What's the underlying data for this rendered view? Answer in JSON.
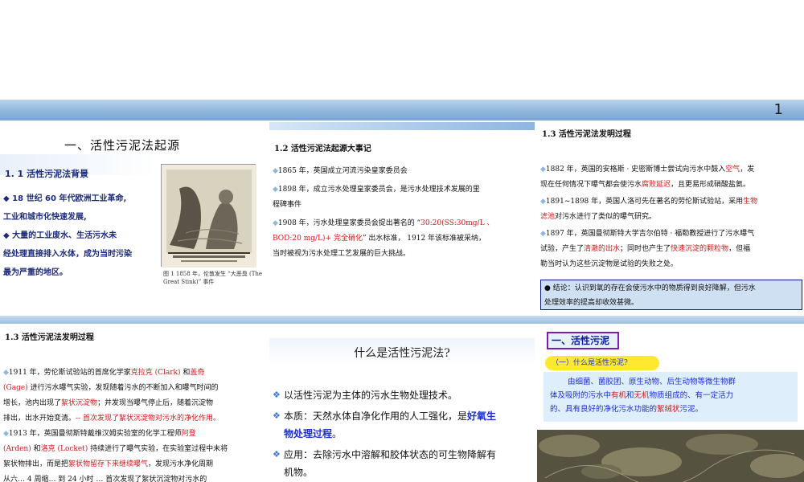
{
  "header": {
    "page_number": "1"
  },
  "panel1": {
    "title": "一、活性污泥法起源",
    "subtitle": "1. 1   活性污泥法背景",
    "lines": [
      "◆     18 世纪 60 年代欧洲工业革命,",
      "工业和城市化快速发展,",
      "◆     大量的工业废水、生活污水未",
      "经处理直接排入水体，成为当时污染",
      "最为严重的地区。"
    ],
    "figure_caption": "图 1 1858 年，伦敦发生 “大恶臭 (The Great Stink)” 事件",
    "figure_inner_text": "FARADAY GIVING HIS CARD TO FATHER THAMES;"
  },
  "panel2": {
    "heading": "1.2  活性污泥法起源大事记",
    "p1": "1865 年，英国成立河流污染皇家委员会",
    "p2a": "1898 年，成立污水处理皇家委员会，是污水处理技术发展的里",
    "p2b": "程碑事件",
    "p3a_pre": "1908 年，污水处理皇家委员会提出著名的 “",
    "p3a_red": "30:20(SS:30mg/L 、",
    "p3b_red": "BOD:20 mg/L)+ 完全硝化",
    "p3b_post": "” 出水标准， 1912 年该标准被采纳，",
    "p3c": "当时被视为污水处理工艺发展的巨大挑战。"
  },
  "panel3": {
    "heading": "1.3  活性污泥法发明过程",
    "a1_pre": "1882 年，英国的安格斯 · 史密斯博士尝试向污水中鼓入",
    "a1_red": "空气",
    "a1_post": "，发",
    "a2_pre": "现在任何情况下曝气都会使污水",
    "a2_red": "腐败延迟",
    "a2_post": "，且更易形成硝酸盐氨。",
    "b1_pre": "1891~1898 年，英国人洛可先在著名的劳伦斯试验站，采用",
    "b1_red": "生物",
    "b2_red": "滤池",
    "b2_post": "对污水进行了类似的曝气研究。",
    "c1": "1897 年，英国曼彻斯特大学吉尔伯特 · 福勒教授进行了污水曝气",
    "c2_pre": "试验，产生了",
    "c2_red1": "清澈的出水",
    "c2_mid": "；同时也产生了",
    "c2_red2": "快速沉淀的颗粒物",
    "c2_post": "，但福",
    "c3": "勒当时认为这些沉淀物是试验的失败之处。",
    "conclusion1": "●  结论：认识到氧的存在会使污水中的物质得到良好降解，但污水",
    "conclusion2": "处理效率的提高却收效甚微。"
  },
  "panel4": {
    "heading": "1.3  活性污泥法发明过程",
    "l1_pre": "1911 年，劳伦斯试验站的首席化学家",
    "l1_red1": "克拉克 (Clark)",
    "l1_mid": " 和",
    "l1_red2": "盖奇",
    "l2_red": "(Gage)",
    "l2_post": " 进行污水曝气实验，发现随着污水的不断加入和曝气时间的",
    "l3_pre": "增长，池内出现了",
    "l3_red": "絮状沉淀物",
    "l3_post": "；并发现当曝气停止后，随着沉淀物",
    "l4_pre": "排出，出水开始变清。",
    "l4_red": "-- 首次发现了絮状沉淀物对污水的净化作用。",
    "l5_pre": "1913 年，英国曼彻斯特戴维汉姆实验室的化学工程师",
    "l5_red": "阿登",
    "l6_red1": "(Arden)",
    "l6_mid": " 和",
    "l6_red2": "洛克 (Locket)",
    "l6_post": " 持续进行了曝气实验，在实验室过程中未将",
    "l7_pre": "絮状物排出，而是把",
    "l7_red": "絮状物留存下来继续曝气",
    "l7_post": "，发现污水净化周期",
    "l8": "从六… 4 周缩… 到 24 小时 … 首次发现了絮状沉淀物对污水的"
  },
  "panel5": {
    "title": "什么是活性污泥法?",
    "i1": "以活性污泥为主体的污水生物处理技术。",
    "i2_pre": "本质：天然水体自净化作用的人工强化，是",
    "i2_blue": "好氧生",
    "i2b_blue": "物处理过程",
    "i2b_post": "。",
    "i3": "应用：去除污水中溶解和胶体状态的可生物降解有",
    "i3b": "机物。"
  },
  "panel6": {
    "tag": "一、活性污泥",
    "question": "（一）什么是活性污泥?",
    "def1": "由细菌、菌胶团、原生动物、后生动物等微生物群",
    "def2_pre": "体及吸附的污水中",
    "def2_red1": "有机",
    "def2_mid": "和",
    "def2_red2": "无机",
    "def2_post": "物质组成的、有一定活力",
    "def3_pre": "的、具有良好的净化污水功能的",
    "def3_red": "絮绒状",
    "def3_post": "污泥。"
  },
  "colors": {
    "banner": "#8fb6dd",
    "accent_red": "#d01818",
    "accent_blue": "#1a2fd0",
    "conclusion_bg": "#cfe0f2",
    "pill_yellow": "#ffe930"
  }
}
